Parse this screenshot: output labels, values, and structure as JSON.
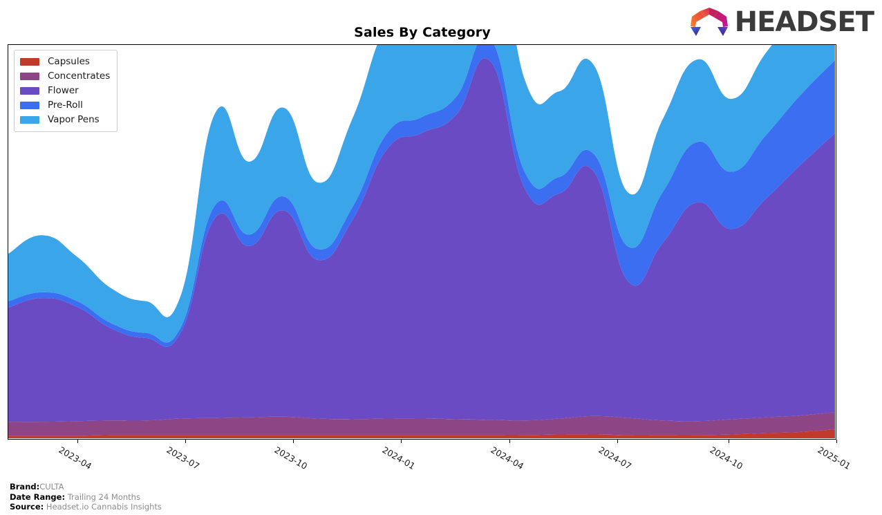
{
  "header": {
    "title": "Sales By Category",
    "logo_text": "HEADSET",
    "logo_icon": "headset-logo-icon"
  },
  "legend": {
    "position": "top-left",
    "items": [
      {
        "label": "Capsules",
        "color": "#c0392b"
      },
      {
        "label": "Concentrates",
        "color": "#8e4585"
      },
      {
        "label": "Flower",
        "color": "#6a4bc4"
      },
      {
        "label": "Pre-Roll",
        "color": "#3b6ef0"
      },
      {
        "label": "Vapor Pens",
        "color": "#3aa5e8"
      }
    ]
  },
  "footer": {
    "brand_key": "Brand:",
    "brand_value": "CULTA",
    "date_range_key": "Date Range:",
    "date_range_value": "Trailing 24 Months",
    "source_key": "Source:",
    "source_value": "Headset.io Cannabis Insights"
  },
  "chart_data": {
    "type": "area",
    "stacked": true,
    "title": "Sales By Category",
    "xlabel": "",
    "ylabel": "",
    "grid": false,
    "legend_position": "top-left",
    "axis_ticks_visible_x": [
      "2023-04",
      "2023-07",
      "2023-10",
      "2024-01",
      "2024-04",
      "2024-07",
      "2024-10",
      "2025-01"
    ],
    "x_tick_positions_frac": [
      0.0843,
      0.2145,
      0.3447,
      0.4749,
      0.6051,
      0.7353,
      0.8698,
      1.0
    ],
    "y_axis_labels_visible": false,
    "x": [
      "2023-01",
      "2023-02",
      "2023-03",
      "2023-04",
      "2023-05",
      "2023-06",
      "2023-07",
      "2023-08",
      "2023-09",
      "2023-10",
      "2023-11",
      "2023-12",
      "2024-01",
      "2024-02",
      "2024-03",
      "2024-04",
      "2024-05",
      "2024-06",
      "2024-07",
      "2024-08",
      "2024-09",
      "2024-10",
      "2024-11",
      "2024-12",
      "2025-01"
    ],
    "series": [
      {
        "name": "Capsules",
        "color": "#c0392b",
        "values": [
          0.4,
          0.4,
          0.4,
          0.5,
          0.5,
          0.5,
          0.5,
          0.5,
          0.5,
          0.5,
          0.5,
          0.5,
          0.5,
          0.5,
          0.5,
          0.5,
          0.6,
          0.6,
          0.5,
          0.5,
          0.5,
          0.6,
          0.8,
          1.0,
          1.4
        ]
      },
      {
        "name": "Concentrates",
        "color": "#8e4585",
        "values": [
          2.2,
          2.2,
          2.3,
          2.3,
          2.3,
          2.6,
          2.7,
          2.8,
          2.9,
          2.6,
          2.5,
          2.6,
          2.6,
          2.5,
          2.4,
          2.3,
          2.5,
          2.9,
          2.7,
          2.3,
          2.2,
          2.4,
          2.5,
          2.6,
          2.7
        ]
      },
      {
        "name": "Flower",
        "color": "#6a4bc4",
        "values": [
          18.0,
          19.5,
          18.0,
          14.5,
          13.0,
          13.5,
          31.5,
          27.0,
          32.5,
          25.0,
          31.5,
          42.5,
          45.0,
          48.0,
          56.5,
          36.5,
          35.5,
          38.5,
          21.5,
          28.0,
          34.5,
          30.0,
          34.5,
          39.5,
          44.0
        ]
      },
      {
        "name": "Pre-Roll",
        "color": "#3b6ef0",
        "values": [
          1.0,
          0.9,
          0.9,
          0.8,
          0.8,
          0.8,
          2.0,
          1.8,
          2.2,
          1.7,
          2.0,
          2.5,
          2.5,
          2.8,
          3.5,
          2.6,
          2.6,
          2.8,
          5.5,
          8.0,
          9.5,
          9.0,
          10.0,
          11.0,
          11.5
        ]
      },
      {
        "name": "Vapor Pens",
        "color": "#3aa5e8",
        "values": [
          7.5,
          9.0,
          7.0,
          5.5,
          5.0,
          5.0,
          14.5,
          11.5,
          14.0,
          10.5,
          14.0,
          17.0,
          15.5,
          17.0,
          22.0,
          14.5,
          13.5,
          14.0,
          8.5,
          11.5,
          13.0,
          11.5,
          13.0,
          13.5,
          15.0
        ]
      }
    ],
    "ylim": [
      0,
      62
    ],
    "total_peak": {
      "period": "2024-03",
      "value": 85.0
    }
  }
}
